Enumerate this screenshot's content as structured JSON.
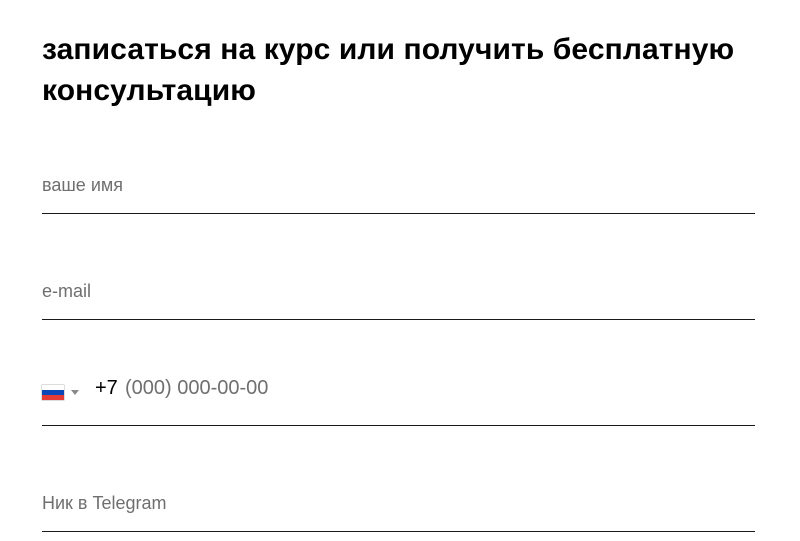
{
  "form": {
    "title": "записаться на курс или получить бесплатную консультацию",
    "name_field": {
      "placeholder": "ваше имя",
      "value": ""
    },
    "email_field": {
      "placeholder": "e-mail",
      "value": ""
    },
    "phone_field": {
      "country_flag": "russia-flag-icon",
      "prefix": "+7",
      "placeholder": "(000) 000-00-00",
      "value": ""
    },
    "telegram_field": {
      "placeholder": "Ник в Telegram",
      "value": ""
    }
  },
  "colors": {
    "text": "#000000",
    "placeholder": "#6f6f6f",
    "underline": "#1a1a1a",
    "flag_white": "#ffffff",
    "flag_blue": "#0c47b7",
    "flag_red": "#e53b35"
  }
}
